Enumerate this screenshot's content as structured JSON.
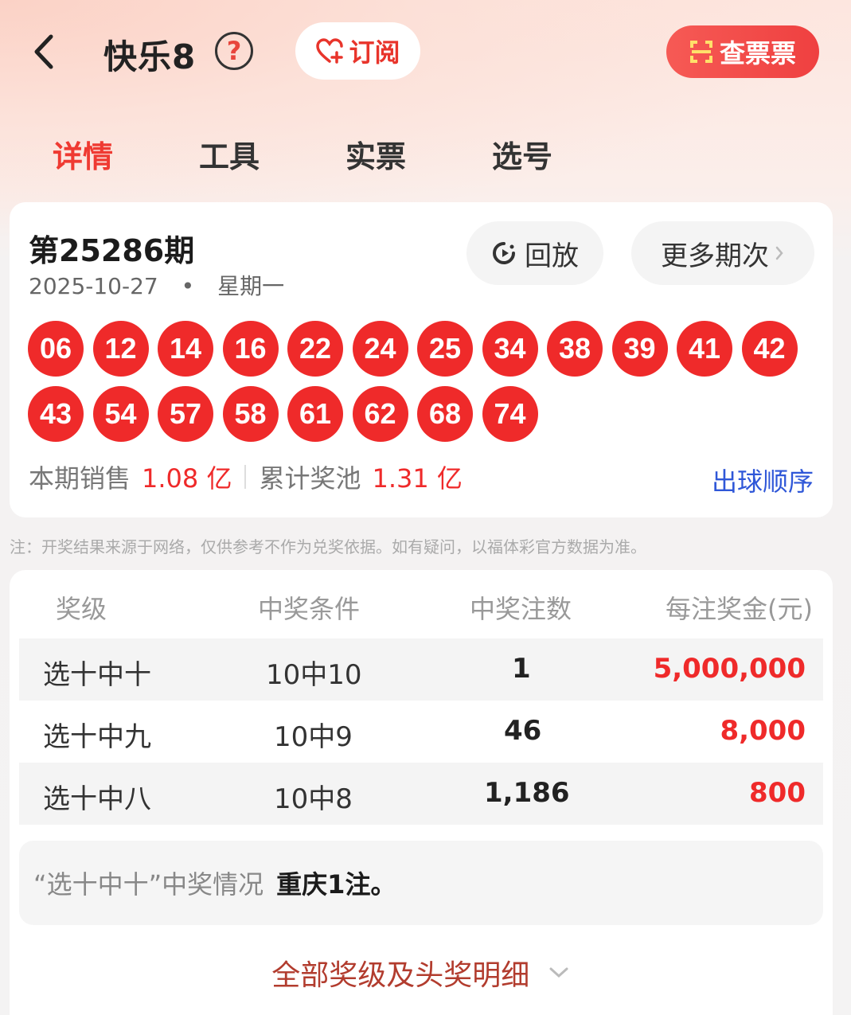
{
  "header": {
    "title": "快乐8",
    "help_label": "?",
    "subscribe_label": "订阅",
    "check_ticket_label": "查票票"
  },
  "tabs": [
    {
      "label": "详情",
      "active": true
    },
    {
      "label": "工具",
      "active": false
    },
    {
      "label": "实票",
      "active": false
    },
    {
      "label": "选号",
      "active": false
    }
  ],
  "draw": {
    "issue": "第25286期",
    "date": "2025-10-27",
    "dot": "•",
    "weekday": "星期一",
    "replay_label": "回放",
    "more_label": "更多期次",
    "numbers": [
      "06",
      "12",
      "14",
      "16",
      "22",
      "24",
      "25",
      "34",
      "38",
      "39",
      "41",
      "42",
      "43",
      "54",
      "57",
      "58",
      "61",
      "62",
      "68",
      "74"
    ],
    "sales_label": "本期销售",
    "sales_value": "1.08 亿",
    "pool_label": "累计奖池",
    "pool_value": "1.31 亿",
    "order_link": "出球顺序"
  },
  "note": "注：开奖结果来源于网络，仅供参考不作为兑奖依据。如有疑问，以福体彩官方数据为准。",
  "prize_table": {
    "headers": [
      "奖级",
      "中奖条件",
      "中奖注数",
      "每注奖金(元)"
    ],
    "rows": [
      {
        "level": "选十中十",
        "condition": "10中10",
        "count": "1",
        "prize": "5,000,000"
      },
      {
        "level": "选十中九",
        "condition": "10中9",
        "count": "46",
        "prize": "8,000"
      },
      {
        "level": "选十中八",
        "condition": "10中8",
        "count": "1,186",
        "prize": "800"
      }
    ]
  },
  "winner_status": {
    "label": "“选十中十”中奖情况",
    "value": "重庆1注。"
  },
  "all_levels_link": "全部奖级及头奖明细",
  "colors": {
    "accent_red": "#ef2a2a",
    "link_blue": "#2f57d8",
    "link_brown": "#b23c2e"
  }
}
